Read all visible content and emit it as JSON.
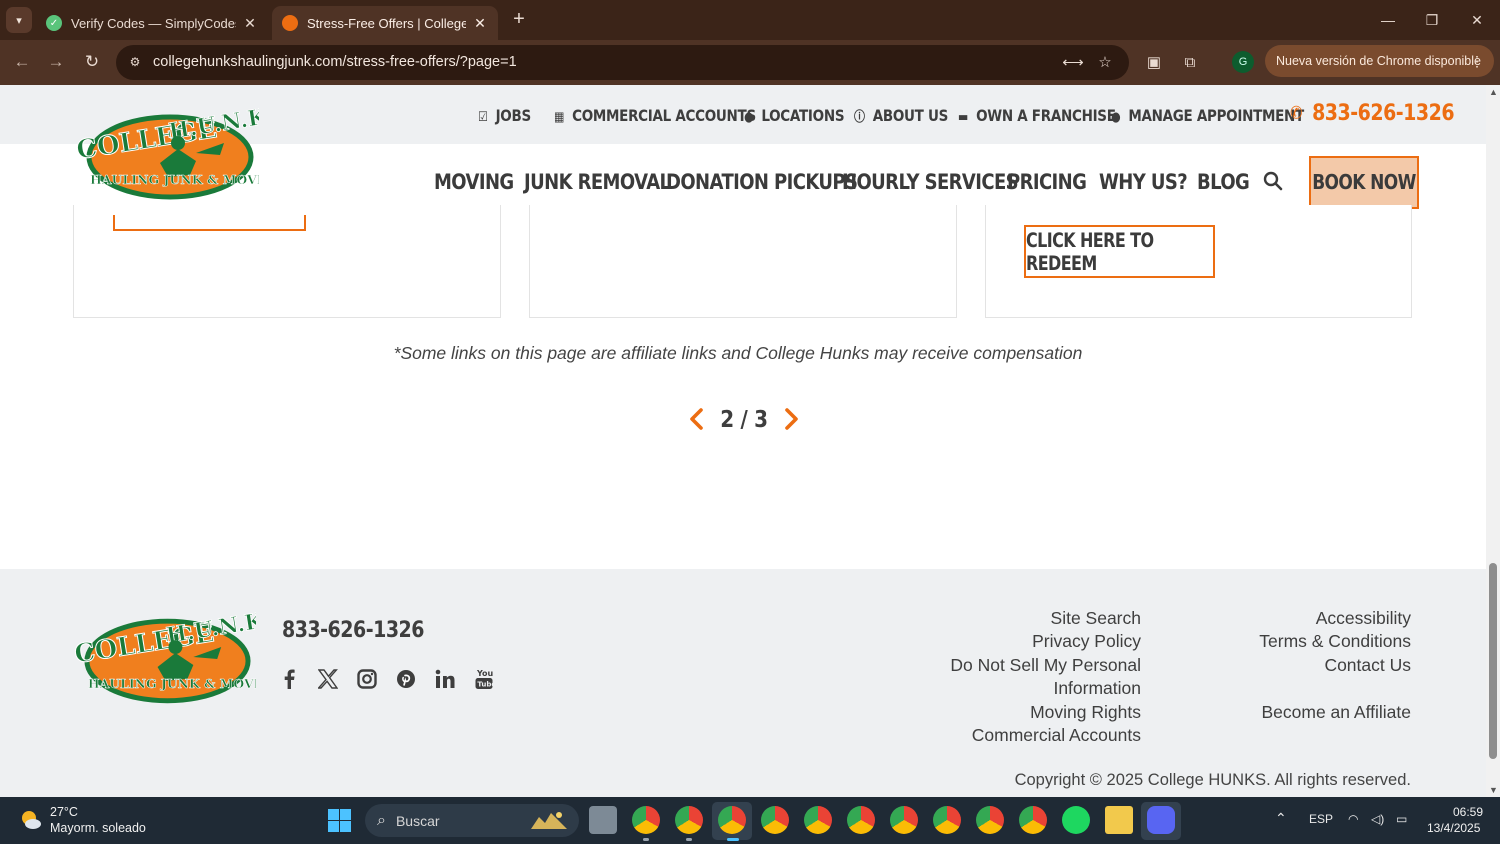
{
  "browser": {
    "tabs": [
      {
        "title": "Verify Codes — SimplyCodes"
      },
      {
        "title": "Stress-Free Offers | College HUNKS"
      }
    ],
    "url": "collegehunkshaulingjunk.com/stress-free-offers/?page=1",
    "profile_initial": "G",
    "update_text": "Nueva versión de Chrome disponible",
    "icons": [
      "tab-search-icon",
      "back-icon",
      "forward-icon",
      "reload-icon",
      "site-settings-icon",
      "translate-icon",
      "star-icon",
      "extension-icon",
      "puzzle-icon",
      "menu-icon"
    ]
  },
  "header": {
    "logo": {
      "line1": "COLLEGE",
      "line2": "H.U.N.K.S.",
      "tagline": "HAULING JUNK & MOVING"
    },
    "utility_links": [
      "JOBS",
      "COMMERCIAL ACCOUNTS",
      "LOCATIONS",
      "ABOUT US",
      "OWN A FRANCHISE",
      "MANAGE APPOINTMENT"
    ],
    "phone": "833-626-1326",
    "nav": [
      "MOVING",
      "JUNK REMOVAL",
      "DONATION PICKUPS",
      "HOURLY SERVICES",
      "PRICING",
      "WHY US?",
      "BLOG"
    ],
    "book_now": "BOOK NOW"
  },
  "offers": {
    "redeem_button": "CLICK HERE TO REDEEM",
    "affiliate_note": "*Some links on this page are affiliate links and College Hunks may receive compensation"
  },
  "pagination": {
    "label": "2 / 3"
  },
  "footer": {
    "phone": "833-626-1326",
    "socials": [
      "facebook-icon",
      "x-icon",
      "instagram-icon",
      "pinterest-icon",
      "linkedin-icon",
      "youtube-icon"
    ],
    "col1": [
      "Site Search",
      "Privacy Policy",
      "Do Not Sell My Personal",
      "Information",
      "Moving Rights",
      "Commercial Accounts"
    ],
    "col2": [
      "Accessibility",
      "Terms & Conditions",
      "Contact Us",
      "Become an Affiliate"
    ],
    "copyright": "Copyright © 2025 College HUNKS. All rights reserved."
  },
  "taskbar": {
    "weather_temp": "27°C",
    "weather_desc": "Mayorm. soleado",
    "search_placeholder": "Buscar",
    "language": "ESP",
    "time": "06:59",
    "date": "13/4/2025"
  },
  "colors": {
    "brand_orange": "#ec6d12",
    "brand_green": "#1a7a3a",
    "chrome_frame": "#3b2418",
    "footer_bg": "#eef0f2"
  }
}
